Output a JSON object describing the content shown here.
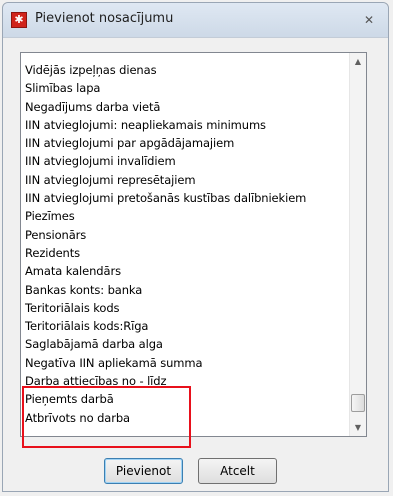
{
  "window": {
    "title": "Pievienot nosacījumu",
    "close_glyph": "✕"
  },
  "list": {
    "items": [
      "Vidējās izpeļņas dienas",
      "Slimības lapa",
      "Negadījums darba vietā",
      "IIN atvieglojumi: neapliekamais minimums",
      "IIN atvieglojumi par apgādājamajiem",
      "IIN atvieglojumi invalīdiem",
      "IIN atvieglojumi represētajiem",
      "IIN atvieglojumi pretošanās kustības dalībniekiem",
      "Piezīmes",
      "Pensionārs",
      "Rezidents",
      "Amata kalendārs",
      "Bankas konts: banka",
      "Teritoriālais kods",
      "Teritoriālais kods:Rīga",
      "Saglabājamā darba alga",
      "Negatīva IIN apliekamā summa",
      "Darba attiecības no - līdz",
      "Pieņemts darbā",
      "Atbrīvots no darba"
    ]
  },
  "scrollbar": {
    "up_glyph": "▲",
    "down_glyph": "▼",
    "position_fraction": 0.98
  },
  "buttons": {
    "add_label": "Pievienot",
    "cancel_label": "Atcelt"
  },
  "colors": {
    "highlight": "#e8101b",
    "app_icon": "#d0241c"
  }
}
